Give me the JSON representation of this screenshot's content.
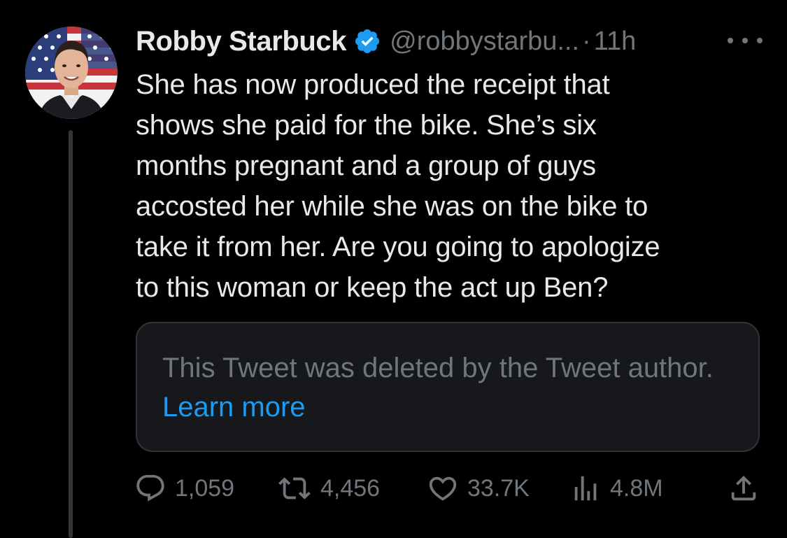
{
  "tweet": {
    "author_name": "Robby Starbuck",
    "handle": "@robbystarbu...",
    "separator": "·",
    "time": "11h",
    "text": "She has now produced the receipt that\nshows she paid for the bike. She’s six\nmonths pregnant and a group of guys\naccosted her while she was on the bike to\ntake it from her. Are you going to apologize\nto this woman or keep the act up Ben?",
    "verified_icon": "verified-badge-icon",
    "more_icon": "more-options-icon"
  },
  "deleted_card": {
    "message": "This Tweet was deleted by the Tweet author.",
    "link_text": "Learn more"
  },
  "actions": {
    "reply_count": "1,059",
    "retweet_count": "4,456",
    "like_count": "33.7K",
    "views_count": "4.8M",
    "reply_icon": "reply-icon",
    "retweet_icon": "retweet-icon",
    "like_icon": "heart-icon",
    "views_icon": "views-chart-icon",
    "share_icon": "share-icon"
  },
  "colors": {
    "background": "#000000",
    "primary_text": "#e7e9ea",
    "secondary_text": "#71767b",
    "link": "#1d9bf0",
    "verified": "#1d9bf0",
    "card_background": "#16181c",
    "card_border": "#2f3336"
  }
}
